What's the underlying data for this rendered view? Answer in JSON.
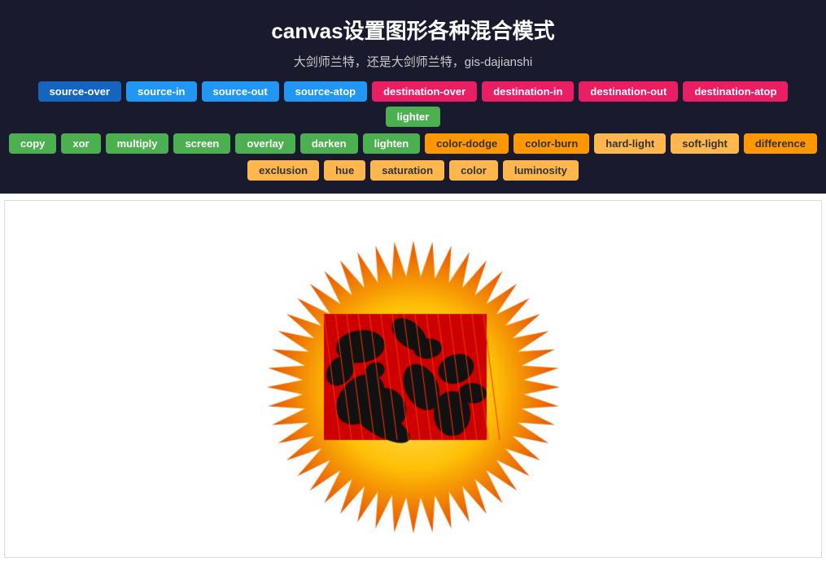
{
  "header": {
    "title": "canvas设置图形各种混合模式",
    "subtitle": "大剑师兰特，还是大剑师兰特，gis-dajianshi"
  },
  "buttons": {
    "row1": [
      {
        "label": "source-over",
        "color": "blue",
        "active": true
      },
      {
        "label": "source-in",
        "color": "blue"
      },
      {
        "label": "source-out",
        "color": "blue"
      },
      {
        "label": "source-atop",
        "color": "blue"
      },
      {
        "label": "destination-over",
        "color": "pink"
      },
      {
        "label": "destination-in",
        "color": "pink"
      },
      {
        "label": "destination-out",
        "color": "pink"
      },
      {
        "label": "destination-atop",
        "color": "pink"
      },
      {
        "label": "lighter",
        "color": "green"
      }
    ],
    "row2": [
      {
        "label": "copy",
        "color": "green"
      },
      {
        "label": "xor",
        "color": "green"
      },
      {
        "label": "multiply",
        "color": "green"
      },
      {
        "label": "screen",
        "color": "green"
      },
      {
        "label": "overlay",
        "color": "green"
      },
      {
        "label": "darken",
        "color": "green"
      },
      {
        "label": "lighten",
        "color": "green"
      },
      {
        "label": "color-dodge",
        "color": "orange"
      },
      {
        "label": "color-burn",
        "color": "orange"
      },
      {
        "label": "hard-light",
        "color": "orange-light"
      },
      {
        "label": "soft-light",
        "color": "orange-light"
      },
      {
        "label": "difference",
        "color": "orange"
      }
    ],
    "row3": [
      {
        "label": "exclusion",
        "color": "orange-light"
      },
      {
        "label": "hue",
        "color": "orange-light"
      },
      {
        "label": "saturation",
        "color": "orange-light"
      },
      {
        "label": "color",
        "color": "orange-light"
      },
      {
        "label": "luminosity",
        "color": "orange-light"
      }
    ]
  }
}
